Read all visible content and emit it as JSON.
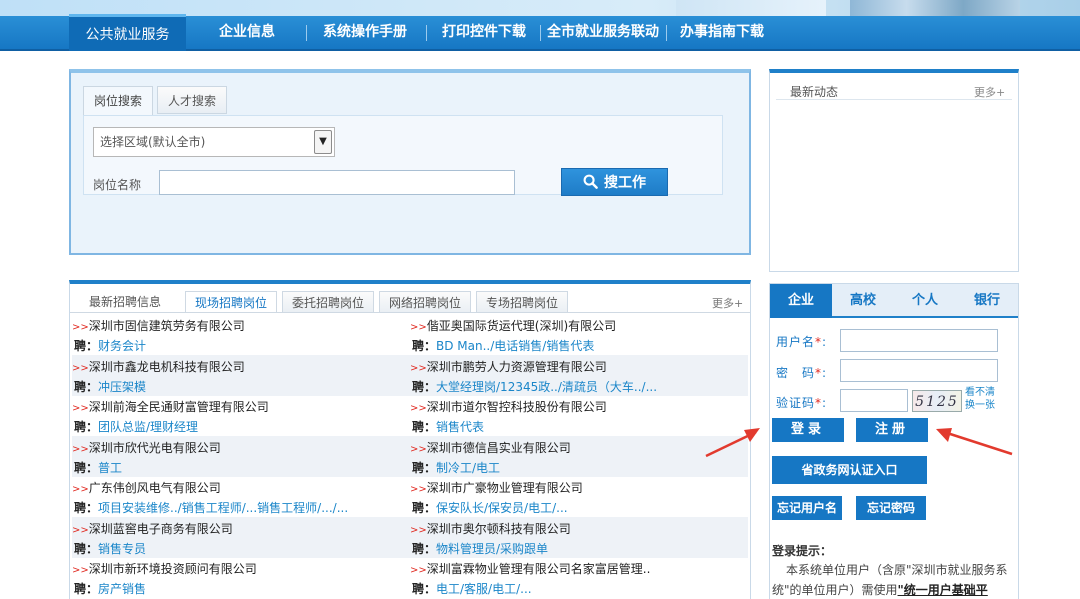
{
  "nav": {
    "items": [
      "公共就业服务",
      "企业信息",
      "系统操作手册",
      "打印控件下载",
      "全市就业服务联动",
      "办事指南下载"
    ]
  },
  "search": {
    "tabs": [
      "岗位搜索",
      "人才搜索"
    ],
    "region_select": "选择区域(默认全市)",
    "position_label": "岗位名称",
    "position_value": "",
    "search_button": "搜工作"
  },
  "news": {
    "title": "最新动态",
    "more": "更多+"
  },
  "jobs": {
    "tabs": [
      "最新招聘信息",
      "现场招聘岗位",
      "委托招聘岗位",
      "网络招聘岗位",
      "专场招聘岗位"
    ],
    "more": "更多+",
    "marker": ">>",
    "prefix": "聘：",
    "rows": [
      [
        {
          "company": "深圳市固信建筑劳务有限公司",
          "positions": "财务会计"
        },
        {
          "company": "偕亚奥国际货运代理(深圳)有限公司",
          "positions": "BD Man../电话销售/销售代表"
        }
      ],
      [
        {
          "company": "深圳市鑫龙电机科技有限公司",
          "positions": "冲压架模"
        },
        {
          "company": "深圳市鹏劳人力资源管理有限公司",
          "positions": "大堂经理岗/12345政../清疏员（大车../..."
        }
      ],
      [
        {
          "company": "深圳前海全民通财富管理有限公司",
          "positions": "团队总监/理财经理"
        },
        {
          "company": "深圳市道尔智控科技股份有限公司",
          "positions": "销售代表"
        }
      ],
      [
        {
          "company": "深圳市欣代光电有限公司",
          "positions": "普工"
        },
        {
          "company": "深圳市德信昌实业有限公司",
          "positions": "制冷工/电工"
        }
      ],
      [
        {
          "company": "广东伟创风电气有限公司",
          "positions": "项目安装维修../销售工程师/...销售工程师/.../..."
        },
        {
          "company": "深圳市广豪物业管理有限公司",
          "positions": "保安队长/保安员/电工/..."
        }
      ],
      [
        {
          "company": "深圳蓝窖电子商务有限公司",
          "positions": "销售专员"
        },
        {
          "company": "深圳市奥尔顿科技有限公司",
          "positions": "物料管理员/采购跟单"
        }
      ],
      [
        {
          "company": "深圳市新环境投资顾问有限公司",
          "positions": "房产销售"
        },
        {
          "company": "深圳富霖物业管理有限公司名家富居管理..",
          "positions": "电工/客服/电工/..."
        }
      ]
    ]
  },
  "login": {
    "tabs": [
      "企业",
      "高校",
      "个人",
      "银行"
    ],
    "username_label": "用户名",
    "password_label": "密　码",
    "captcha_label": "验证码",
    "required_mark": "*",
    "colon": ":",
    "captcha_text": "5125",
    "refresh_text_1": "看不清",
    "refresh_text_2": "换一张",
    "login_button": "登录",
    "register_button": "注册",
    "gov_button": "省政务网认证入口",
    "forgot_user": "忘记用户名",
    "forgot_pass": "忘记密码",
    "tip_title": "登录提示：",
    "tip_text": "本系统单位用户（含原\"深圳市就业服务系统\"的单位用户）需使用",
    "tip_bold": "\"统一用户基础平"
  },
  "colors": {
    "primary": "#1677c4",
    "link": "#1b86c9",
    "marker_red": "#e0281f",
    "arrow_red": "#e23a2e"
  }
}
